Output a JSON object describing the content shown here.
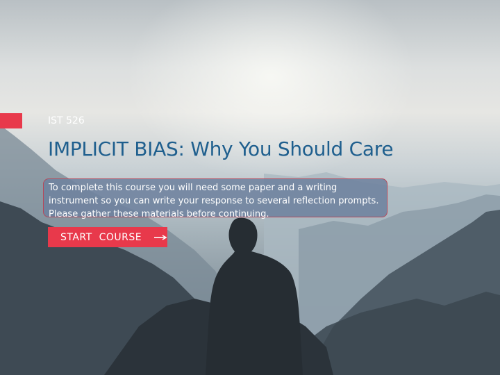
{
  "slide": {
    "course_code": "IST 526",
    "title": "IMPLICIT BIAS: Why You Should Care",
    "notice": "To complete this course you will need some paper and a writing instrument so you can write your response to several reflection prompts. Please gather these materials before continuing.",
    "start_button_label": "START  COURSE",
    "start_button_icon": "arrow-right-icon"
  },
  "colors": {
    "accent": "#e8394b",
    "title": "#1f5f8e",
    "notice_background": "#6e829e",
    "notice_border": "#b5485a"
  }
}
